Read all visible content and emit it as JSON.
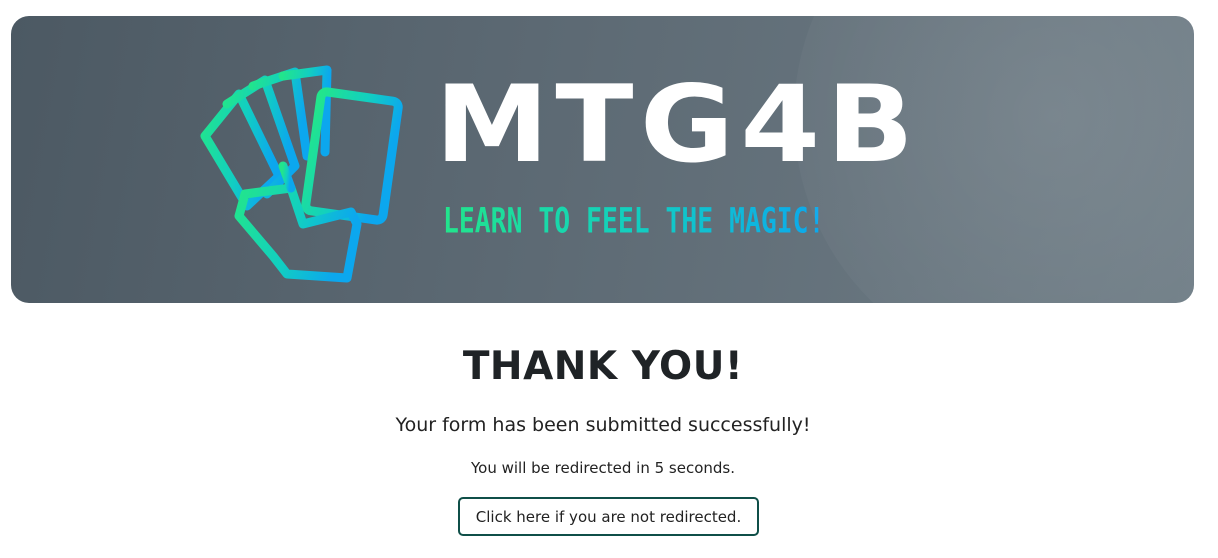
{
  "banner": {
    "brand_name": "MTG4B",
    "tagline": "LEARN TO FEEL THE MAGIC!",
    "logo_icon": "hand-holding-cards-icon",
    "gradient_colors": [
      "#22e58c",
      "#12cfc0",
      "#0ca7ee"
    ]
  },
  "content": {
    "heading": "THANK YOU!",
    "message": "Your form has been submitted successfully!",
    "redirect_note": "You will be redirected in 5 seconds.",
    "redirect_link_label": "Click here if you are not redirected."
  },
  "colors": {
    "button_border": "#0f4f48",
    "heading_text": "#1f2326"
  }
}
